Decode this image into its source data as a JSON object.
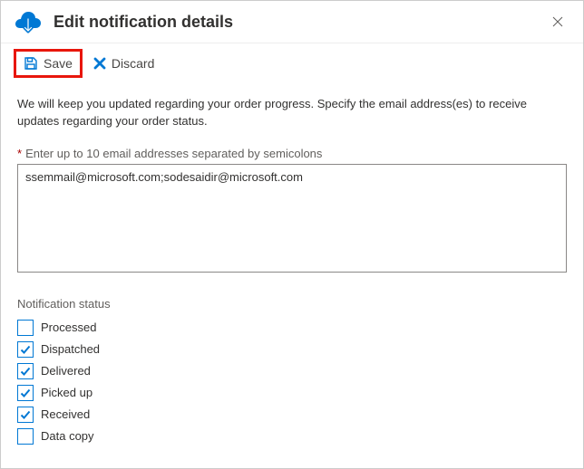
{
  "header": {
    "title": "Edit notification details"
  },
  "toolbar": {
    "save_label": "Save",
    "discard_label": "Discard"
  },
  "content": {
    "description": "We will keep you updated regarding your order progress. Specify the email address(es) to receive updates regarding your order status.",
    "email_field_label": "Enter up to 10 email addresses separated by semicolons",
    "email_value": "ssemmail@microsoft.com;sodesaidir@microsoft.com",
    "status_section_label": "Notification status",
    "statuses": [
      {
        "label": "Processed",
        "checked": false
      },
      {
        "label": "Dispatched",
        "checked": true
      },
      {
        "label": "Delivered",
        "checked": true
      },
      {
        "label": "Picked up",
        "checked": true
      },
      {
        "label": "Received",
        "checked": true
      },
      {
        "label": "Data copy",
        "checked": false
      }
    ]
  },
  "colors": {
    "accent": "#0078d4",
    "highlight_border": "#e8160c"
  }
}
